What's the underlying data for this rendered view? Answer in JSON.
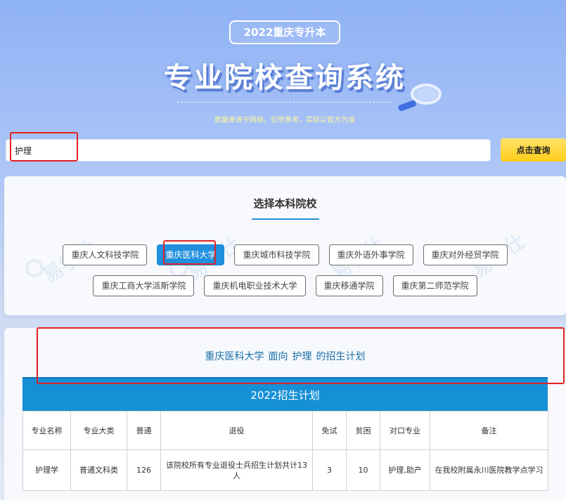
{
  "header": {
    "year_badge": "2022重庆专升本",
    "title": "专业院校查询系统",
    "disclaimer": "数据来源于网络，仅供参考，实际以官方为准"
  },
  "search": {
    "value": "护理",
    "button_label": "点击查询"
  },
  "schools": {
    "title": "选择本科院校",
    "row1": [
      "重庆人文科技学院",
      "重庆医科大学",
      "重庆城市科技学院",
      "重庆外语外事学院",
      "重庆对外经贸学院"
    ],
    "row2": [
      "重庆工商大学派斯学院",
      "重庆机电职业技术大学",
      "重庆移通学院",
      "重庆第二师范学院"
    ],
    "selected": "重庆医科大学"
  },
  "plan": {
    "school": "重庆医科大学",
    "prefix": "面向",
    "major": "护理",
    "suffix": "的招生计划",
    "banner": "2022招生计划",
    "columns": [
      "专业名称",
      "专业大类",
      "普通",
      "退役",
      "免试",
      "贫困",
      "对口专业",
      "备注"
    ],
    "rows": [
      [
        "护理学",
        "普通文科类",
        "126",
        "该院校所有专业退役士兵招生计划共计13人",
        "3",
        "10",
        "护理,助产",
        "在我校附属永川医院教学点学习"
      ]
    ]
  },
  "watermark": {
    "text": "易学仕"
  },
  "colors": {
    "accent_blue": "#1f8fde",
    "button_yellow": "#ffcc18",
    "highlight_red": "#e52020",
    "heading_blue": "#1a6fa8"
  }
}
